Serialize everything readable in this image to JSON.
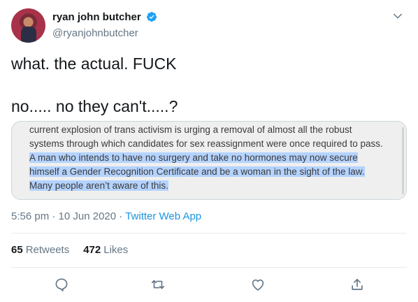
{
  "author": {
    "display_name": "ryan john butcher",
    "handle": "@ryanjohnbutcher",
    "verified": true
  },
  "tweet": {
    "line1": "what. the actual. FUCK",
    "line2": "no..... no they can't.....?"
  },
  "media": {
    "lines": [
      "current explosion of trans activism is urging a removal of almost all the robust",
      "systems through which candidates for sex reassignment were once required to pass.",
      "A man who intends to have no surgery and take no hormones may now secure",
      "himself a Gender Recognition Certificate and be a woman in the sight of the law.",
      "Many people aren’t aware of this."
    ]
  },
  "meta": {
    "time": "5:56 pm",
    "separator": " · ",
    "date": "10 Jun 2020",
    "source": "Twitter Web App"
  },
  "stats": {
    "retweets_count": "65",
    "retweets_label": "Retweets",
    "likes_count": "472",
    "likes_label": "Likes"
  },
  "icons": [
    "verified-badge-icon",
    "chevron-down-icon",
    "reply-icon",
    "retweet-icon",
    "like-icon",
    "share-icon"
  ],
  "colors": {
    "accent": "#1b95e0",
    "secondary_text": "#657786",
    "highlight": "#b5d3ff",
    "divider": "#e6ecf0"
  }
}
